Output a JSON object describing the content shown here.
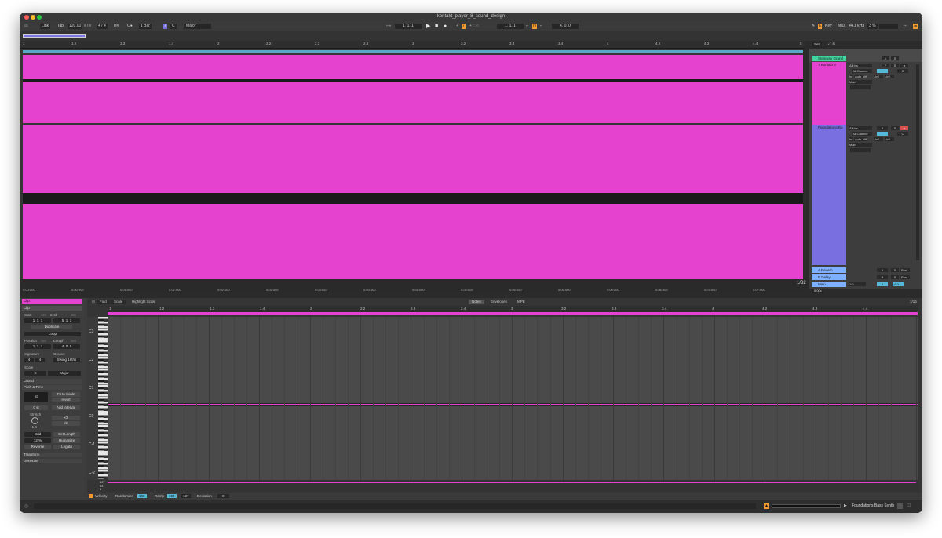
{
  "window": {
    "title": "kontakt_player_8_sound_design"
  },
  "control_bar": {
    "link": "Link",
    "tap": "Tap",
    "tempo": "120.00",
    "meter": "4 / 4",
    "swing": "0%",
    "metronome": "O●",
    "quantize": "1 Bar",
    "key": "C",
    "scale": "Major",
    "position": "1.  1.  1",
    "loop_start": "1.  1.  1",
    "loop_length": "4.  0.  0",
    "key_map": "Key",
    "midi_map": "MIDI",
    "sample_rate": "44.1 kHz",
    "cpu": "3 %"
  },
  "ruler": {
    "bars": [
      "1",
      "1.2",
      "1.3",
      "1.4",
      "2",
      "2.2",
      "2.3",
      "2.4",
      "3",
      "3.2",
      "3.3",
      "3.4",
      "4",
      "4.2",
      "4.3",
      "4.4",
      "5"
    ],
    "set": "Set"
  },
  "tracks": [
    {
      "name": "Steinway Grand",
      "color": "#3fd6a1"
    },
    {
      "name": "7 Kontakt 8",
      "color": "#e542cf",
      "input": "All Ins",
      "channel": "All Channe",
      "monitor_in": "In",
      "monitor_auto": "Auto",
      "monitor_off": "Off",
      "out": "Main",
      "vol": "-inf",
      "pan": "-inf",
      "num": "7",
      "solo": "S",
      "arm": "●",
      "send": "C"
    },
    {
      "name": "Foundations Ba",
      "color": "#7a6fe0",
      "input": "All Ins",
      "channel": "All Channe",
      "monitor_in": "In",
      "monitor_auto": "Auto",
      "monitor_off": "Off",
      "out": "Main",
      "vol": "-inf",
      "pan": "-inf",
      "num": "8",
      "solo": "S",
      "arm": "●",
      "send": "C"
    },
    {
      "name": "A Reverb",
      "color": "#7fb0ff",
      "num": "A",
      "solo": "S",
      "post": "Post"
    },
    {
      "name": "B Delay",
      "color": "#7fb0ff",
      "num": "B",
      "solo": "S",
      "post": "Post"
    },
    {
      "name": "Main",
      "color": "#7fb0ff",
      "fraction": "1/2",
      "val": "0",
      "db": "-6.0"
    }
  ],
  "time_ruler": {
    "labels": [
      "0:00:000",
      "0:00:500",
      "0:01:000",
      "0:01:500",
      "0:02:000",
      "0:02:500",
      "0:03:000",
      "0:03:500",
      "0:04:000",
      "0:04:500",
      "0:05:000",
      "0:05:500",
      "0:06:000",
      "0:06:500",
      "0:07:000",
      "0:07:500"
    ],
    "grid": "1/32",
    "zoom": "0.00x"
  },
  "clip_panel": {
    "clip_label": "Clip",
    "clip_name": "Clip",
    "start_label": "Start",
    "set_label": "Set",
    "end_label": "End",
    "start": "1.  1.  1",
    "end": "5.  1.  1",
    "duplicate": "Duplicate",
    "loop": "Loop",
    "position_label": "Position",
    "length_label": "Length",
    "position": "1.  1.  1",
    "length": "4.  0.  0",
    "signature_label": "Signature",
    "groove_label": "Groove",
    "sig_num": "4",
    "sig_den": "4",
    "groove": "Swing 16ths",
    "scale_label": "Scale",
    "scale_key": "C",
    "scale_name": "Major",
    "launch": "Launch",
    "pitch_time": "Pitch & Time",
    "transpose": "st",
    "fit": "Fit to Scale",
    "invert": "Invert",
    "zero_st": "0 st",
    "add_interval": "Add Interval",
    "stretch": "Stretch",
    "stretch_val": "+1.0",
    "x2": "×2",
    "div2": "/2",
    "grid": "Grid",
    "set_length": "Set Length",
    "humanize_pct": "12 %",
    "humanize": "Humanize",
    "reverse": "Reverse",
    "legato": "Legato",
    "transform": "Transform",
    "generate": "Generate"
  },
  "editor": {
    "fold": "Fold",
    "scale": "Scale",
    "highlight": "Highlight Scale",
    "notes": "Notes",
    "envelopes": "Envelopes",
    "mpe": "MPE",
    "grid": "1/16",
    "bars": [
      "1",
      "1.2",
      "1.3",
      "1.4",
      "2",
      "2.2",
      "2.3",
      "2.4",
      "3",
      "3.2",
      "3.3",
      "3.4",
      "4",
      "4.2",
      "4.3",
      "4.4"
    ],
    "octaves": [
      "C3",
      "C2",
      "C1",
      "C0",
      "C-1",
      "C-2"
    ],
    "vel_ticks": [
      "127",
      "64",
      "1"
    ]
  },
  "vel_bar": {
    "velocity": "Velocity",
    "randomize": "Randomize",
    "rand_val": "100",
    "ramp": "Ramp",
    "ramp_a": "100",
    "ramp_b": "127",
    "deviation": "Deviation",
    "dev_val": "0"
  },
  "status": {
    "instrument": "Foundations Bass Synth"
  },
  "colors": {
    "clip": "#e542cf",
    "accent": "#f29b2e"
  }
}
